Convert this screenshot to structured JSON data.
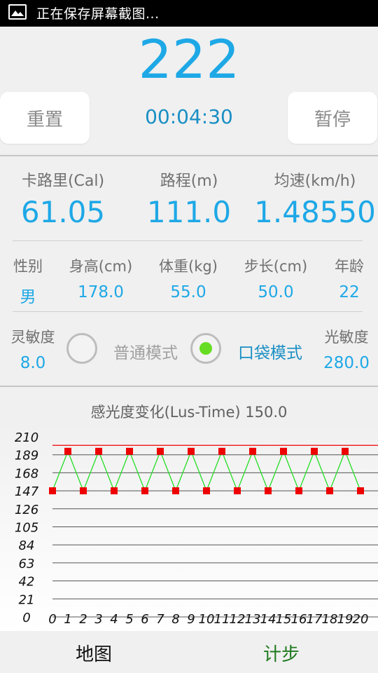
{
  "status_bar": {
    "text": "正在保存屏幕截图..."
  },
  "counter": {
    "value": "222"
  },
  "controls": {
    "reset_label": "重置",
    "timer": "00:04:30",
    "pause_label": "暂停"
  },
  "metrics": [
    {
      "label": "卡路里(Cal)",
      "value": "61.05"
    },
    {
      "label": "路程(m)",
      "value": "111.0"
    },
    {
      "label": "均速(km/h)",
      "value": "1.48550"
    }
  ],
  "profile": [
    {
      "label": "性别",
      "value": "男"
    },
    {
      "label": "身高(cm)",
      "value": "178.0"
    },
    {
      "label": "体重(kg)",
      "value": "55.0"
    },
    {
      "label": "步长(cm)",
      "value": "50.0"
    },
    {
      "label": "年龄",
      "value": "22"
    }
  ],
  "sensitivity": {
    "label": "灵敏度",
    "value": "8.0"
  },
  "modes": {
    "normal_label": "普通模式",
    "pocket_label": "口袋模式",
    "selected": "pocket"
  },
  "light": {
    "label": "光敏度",
    "value": "280.0"
  },
  "chart_data": {
    "type": "line",
    "title": "感光度变化(Lus-Time)  150.0",
    "x": [
      0,
      1,
      2,
      3,
      4,
      5,
      6,
      7,
      8,
      9,
      10,
      11,
      12,
      13,
      14,
      15,
      16,
      17,
      18,
      19,
      20
    ],
    "x_tick_labels": [
      "0",
      "1",
      "2",
      "3",
      "4",
      "5",
      "6",
      "7",
      "8",
      "9",
      "10",
      "11",
      "12",
      "13",
      "14",
      "15",
      "16",
      "17",
      "18",
      "19",
      "20"
    ],
    "y_ticks": [
      0,
      21,
      42,
      63,
      84,
      105,
      126,
      147,
      168,
      189,
      210
    ],
    "ylim": [
      0,
      210
    ],
    "threshold": 200,
    "series": [
      {
        "values": [
          147,
          193,
          147,
          193,
          147,
          193,
          147,
          193,
          147,
          193,
          147,
          193,
          147,
          193,
          147,
          193,
          147,
          193,
          147,
          193,
          147
        ]
      }
    ],
    "colors": {
      "line": "#22dd22",
      "marker": "#ee0000",
      "threshold": "#ee0000",
      "grid": "#555555"
    },
    "grid": true
  },
  "tabs": [
    {
      "label": "地图",
      "active": false
    },
    {
      "label": "计步",
      "active": true
    }
  ],
  "colors": {
    "accent": "#1ea8e6",
    "active_tab": "#1f7a1f"
  }
}
